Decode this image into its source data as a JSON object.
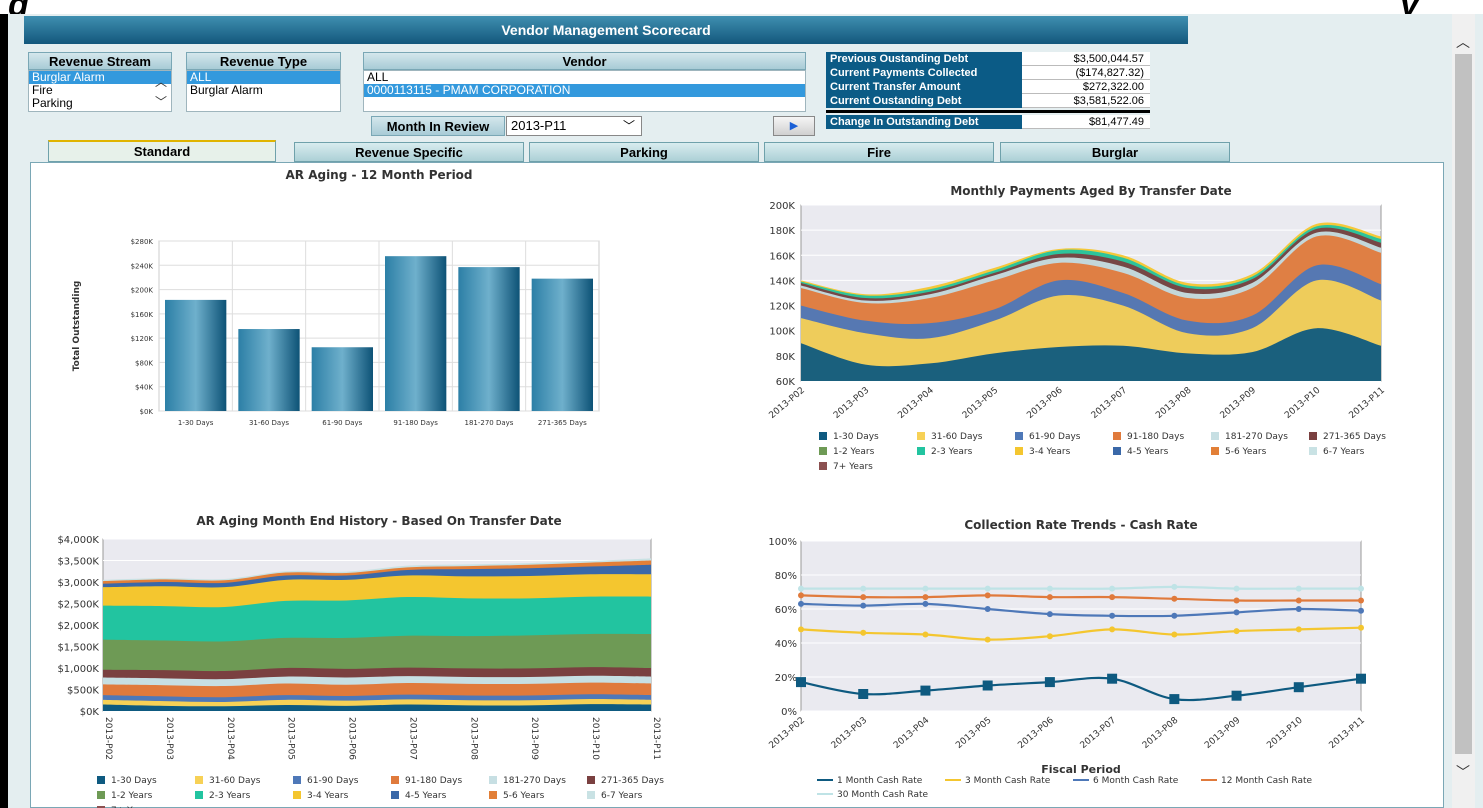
{
  "page": {
    "heading_fragment_left": "g",
    "heading_fragment_right": "y"
  },
  "app": {
    "title": "Vendor Management Scorecard"
  },
  "filters": {
    "revenue_stream": {
      "label": "Revenue Stream",
      "items": [
        "Burglar Alarm",
        "Fire",
        "Parking"
      ],
      "selected": "Burglar Alarm"
    },
    "revenue_type": {
      "label": "Revenue Type",
      "items": [
        "ALL",
        "Burglar Alarm"
      ],
      "selected": "ALL"
    },
    "vendor": {
      "label": "Vendor",
      "items": [
        "ALL",
        "0000113115 - PMAM CORPORATION"
      ],
      "selected": "0000113115 - PMAM CORPORATION"
    },
    "month": {
      "label": "Month In Review",
      "value": "2013-P11"
    }
  },
  "debt": [
    {
      "label": "Previous Oustanding Debt",
      "value": "$3,500,044.57"
    },
    {
      "label": "Current Payments Collected",
      "value": "($174,827.32)"
    },
    {
      "label": "Current Transfer Amount",
      "value": "$272,322.00"
    },
    {
      "label": "Current Oustanding Debt",
      "value": "$3,581,522.06"
    },
    {
      "label": "Change In Outstanding Debt",
      "value": "$81,477.49"
    }
  ],
  "tabs": [
    "Standard",
    "Revenue Specific",
    "Parking",
    "Fire",
    "Burglar"
  ],
  "active_tab": "Standard",
  "colors": {
    "banner": "#1b6a92",
    "header_cell": "#0b5b86",
    "bar": "#1e6a8e",
    "plot_bg": "#eaeaf0"
  },
  "legend_aging": [
    {
      "name": "1-30 Days",
      "color": "#0e5a80"
    },
    {
      "name": "31-60 Days",
      "color": "#f7d156"
    },
    {
      "name": "61-90 Days",
      "color": "#4e78b8"
    },
    {
      "name": "91-180 Days",
      "color": "#e07a3c"
    },
    {
      "name": "181-270 Days",
      "color": "#c7dfe3"
    },
    {
      "name": "271-365 Days",
      "color": "#7a4040"
    },
    {
      "name": "1-2 Years",
      "color": "#6e9a55"
    },
    {
      "name": "2-3 Years",
      "color": "#22c4a0"
    },
    {
      "name": "3-4 Years",
      "color": "#f4c62f"
    },
    {
      "name": "4-5 Years",
      "color": "#3a68a8"
    },
    {
      "name": "5-6 Years",
      "color": "#e27f37"
    },
    {
      "name": "6-7 Years",
      "color": "#c9e2e4"
    },
    {
      "name": "7+ Years",
      "color": "#8b5050"
    }
  ],
  "chart_data": [
    {
      "type": "bar",
      "title": "AR Aging - 12 Month Period",
      "ylabel": "Total Outstanding",
      "categories": [
        "1-30 Days",
        "31-60 Days",
        "61-90 Days",
        "91-180 Days",
        "181-270 Days",
        "271-365 Days"
      ],
      "values": [
        183000,
        135000,
        105000,
        255000,
        237000,
        218000
      ],
      "ylim": [
        0,
        280000
      ],
      "yticks": [
        "$0K",
        "$40K",
        "$80K",
        "$120K",
        "$160K",
        "$200K",
        "$240K",
        "$280K"
      ],
      "grid": true
    },
    {
      "type": "area",
      "title": "Monthly Payments Aged By Transfer Date",
      "categories": [
        "2013-P02",
        "2013-P03",
        "2013-P04",
        "2013-P05",
        "2013-P06",
        "2013-P07",
        "2013-P08",
        "2013-P09",
        "2013-P10",
        "2013-P11"
      ],
      "ylim": [
        60000,
        200000
      ],
      "yticks": [
        "60K",
        "80K",
        "100K",
        "120K",
        "140K",
        "160K",
        "180K",
        "200K"
      ],
      "stacked": true,
      "series": [
        {
          "name": "1-30 Days",
          "values": [
            90,
            73,
            74,
            82,
            87,
            88,
            82,
            83,
            102,
            88
          ]
        },
        {
          "name": "31-60 Days",
          "values": [
            110,
            98,
            94,
            108,
            128,
            120,
            98,
            102,
            140,
            124
          ]
        },
        {
          "name": "61-90 Days",
          "values": [
            120,
            108,
            106,
            117,
            140,
            130,
            108,
            112,
            152,
            137
          ]
        },
        {
          "name": "91-180 Days",
          "values": [
            134,
            122,
            126,
            140,
            154,
            146,
            126,
            134,
            175,
            162
          ]
        },
        {
          "name": "181-270 Days",
          "values": [
            136,
            124,
            129,
            144,
            158,
            151,
            130,
            138,
            178,
            166
          ]
        },
        {
          "name": "271-365 Days",
          "values": [
            138,
            126,
            131,
            146,
            161,
            155,
            134,
            141,
            181,
            170
          ]
        },
        {
          "name": "2-3 Years",
          "values": [
            139,
            128,
            133,
            148,
            164,
            158,
            136,
            143,
            183,
            173
          ]
        },
        {
          "name": "3-4 Years",
          "values": [
            140,
            129,
            135,
            150,
            165,
            160,
            138,
            145,
            185,
            175
          ]
        }
      ]
    },
    {
      "type": "area",
      "title": "AR Aging Month End History - Based On Transfer Date",
      "categories": [
        "2013-P02",
        "2013-P03",
        "2013-P04",
        "2013-P05",
        "2013-P06",
        "2013-P07",
        "2013-P08",
        "2013-P09",
        "2013-P10",
        "2013-P11"
      ],
      "ylim": [
        0,
        4000
      ],
      "yticks": [
        "$0K",
        "$500K",
        "$1,000K",
        "$1,500K",
        "$2,000K",
        "$2,500K",
        "$3,000K",
        "$3,500K",
        "$4,000K"
      ],
      "stacked": true,
      "series": [
        {
          "name": "1-30 Days",
          "values": [
            150,
            120,
            110,
            140,
            120,
            150,
            130,
            130,
            160,
            150
          ]
        },
        {
          "name": "31-60 Days",
          "values": [
            260,
            230,
            210,
            260,
            240,
            270,
            250,
            250,
            280,
            260
          ]
        },
        {
          "name": "61-90 Days",
          "values": [
            370,
            340,
            320,
            370,
            350,
            380,
            360,
            360,
            390,
            370
          ]
        },
        {
          "name": "91-180 Days",
          "values": [
            620,
            600,
            580,
            640,
            610,
            650,
            630,
            630,
            660,
            640
          ]
        },
        {
          "name": "181-270 Days",
          "values": [
            780,
            760,
            740,
            800,
            780,
            810,
            790,
            790,
            820,
            800
          ]
        },
        {
          "name": "271-365 Days",
          "values": [
            960,
            950,
            930,
            1000,
            980,
            1010,
            990,
            990,
            1020,
            1000
          ]
        },
        {
          "name": "1-2 Years",
          "values": [
            1660,
            1640,
            1620,
            1700,
            1700,
            1750,
            1740,
            1760,
            1790,
            1790
          ]
        },
        {
          "name": "2-3 Years",
          "values": [
            2450,
            2440,
            2420,
            2560,
            2570,
            2650,
            2620,
            2620,
            2660,
            2660
          ]
        },
        {
          "name": "3-4 Years",
          "values": [
            2880,
            2900,
            2880,
            3050,
            3050,
            3150,
            3130,
            3140,
            3180,
            3180
          ]
        },
        {
          "name": "4-5 Years",
          "values": [
            2960,
            3000,
            2980,
            3150,
            3150,
            3280,
            3300,
            3320,
            3360,
            3400
          ]
        },
        {
          "name": "5-6 Years",
          "values": [
            3020,
            3060,
            3040,
            3220,
            3210,
            3340,
            3370,
            3400,
            3450,
            3500
          ]
        },
        {
          "name": "6-7 Years",
          "values": [
            3050,
            3090,
            3070,
            3250,
            3240,
            3380,
            3410,
            3440,
            3490,
            3550
          ]
        }
      ]
    },
    {
      "type": "line",
      "title": "Collection Rate Trends - Cash Rate",
      "xlabel": "Fiscal Period",
      "categories": [
        "2013-P02",
        "2013-P03",
        "2013-P04",
        "2013-P05",
        "2013-P06",
        "2013-P07",
        "2013-P08",
        "2013-P09",
        "2013-P10",
        "2013-P11"
      ],
      "ylim": [
        0,
        100
      ],
      "yticks": [
        "0%",
        "20%",
        "40%",
        "60%",
        "80%",
        "100%"
      ],
      "series": [
        {
          "name": "1 Month Cash Rate",
          "color": "#0e5a80",
          "values": [
            17,
            10,
            12,
            15,
            17,
            19,
            7,
            9,
            14,
            19
          ]
        },
        {
          "name": "3 Month Cash Rate",
          "color": "#f4c62f",
          "values": [
            48,
            46,
            45,
            42,
            44,
            48,
            45,
            47,
            48,
            49
          ]
        },
        {
          "name": "6 Month Cash Rate",
          "color": "#4e78b8",
          "values": [
            63,
            62,
            63,
            60,
            57,
            56,
            56,
            58,
            60,
            59
          ]
        },
        {
          "name": "12 Month Cash Rate",
          "color": "#e07a3c",
          "values": [
            68,
            67,
            67,
            68,
            67,
            67,
            66,
            65,
            65,
            65
          ]
        },
        {
          "name": "30 Month Cash Rate",
          "color": "#bfe3e6",
          "values": [
            72,
            72,
            72,
            72,
            72,
            72,
            73,
            72,
            72,
            72
          ]
        }
      ]
    }
  ]
}
